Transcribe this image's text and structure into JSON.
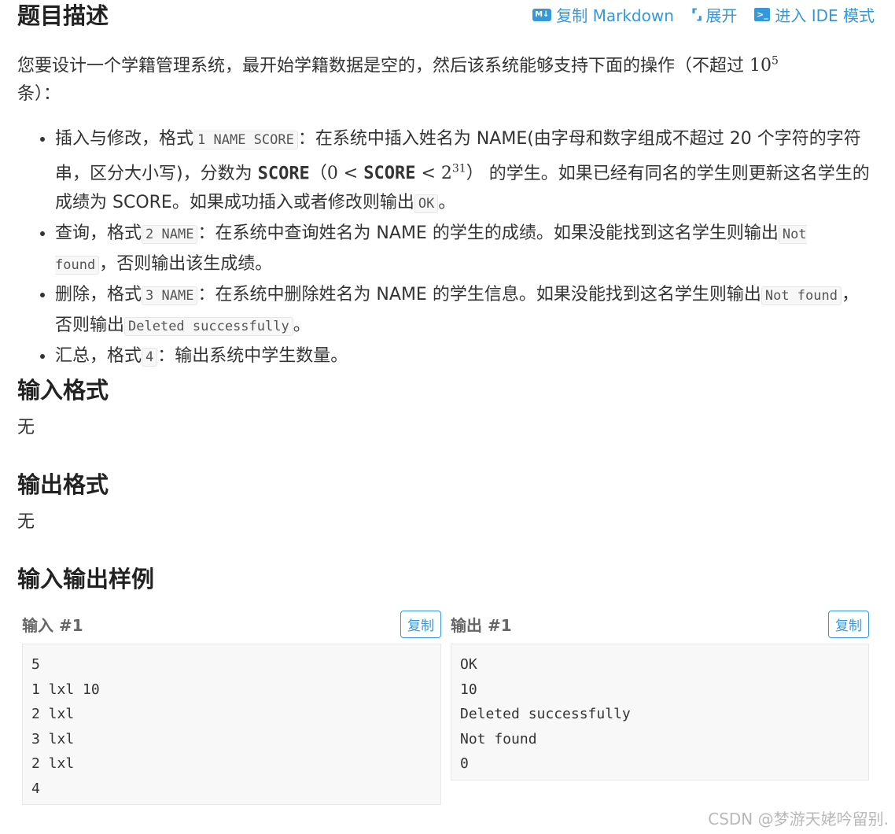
{
  "header": {
    "title": "题目描述",
    "toolbar": {
      "copy_markdown": "复制 Markdown",
      "md_icon_text": "M↓",
      "expand": "展开",
      "ide_mode": "进入 IDE 模式",
      "term_icon_text": ">_"
    }
  },
  "description": {
    "text_before": "您要设计一个学籍管理系统，最开始学籍数据是空的，然后该系统能够支持下面的操作（不超过 ",
    "limit_base": "10",
    "limit_exp": "5",
    "text_after": "条）："
  },
  "operations": [
    {
      "pre": "插入与修改，格式",
      "code": "1 NAME SCORE",
      "mid": "：在系统中插入姓名为 NAME(由字母和数字组成不超过 20 个字符的字符串，区分大小写)，分数为 ",
      "score_var": "SCORE",
      "math_open": "（0 < ",
      "math_lt": " < 2",
      "math_exp": "31",
      "math_close": "）",
      "post": " 的学生。如果已经有同名的学生则更新这名学生的成绩为 SCORE。如果成功插入或者修改则输出",
      "code2": "OK",
      "end": "。"
    },
    {
      "pre": "查询，格式",
      "code": "2 NAME",
      "mid": "：在系统中查询姓名为 NAME 的学生的成绩。如果没能找到这名学生则输出",
      "code2": "Not found",
      "end": "，否则输出该生成绩。"
    },
    {
      "pre": "删除，格式",
      "code": "3 NAME",
      "mid": "：在系统中删除姓名为 NAME 的学生信息。如果没能找到这名学生则输出",
      "code2": "Not found",
      "mid2": "，否则输出",
      "code3": "Deleted successfully",
      "end": "。"
    },
    {
      "pre": "汇总，格式",
      "code": "4",
      "mid": "：输出系统中学生数量。"
    }
  ],
  "input_format": {
    "title": "输入格式",
    "body": "无"
  },
  "output_format": {
    "title": "输出格式",
    "body": "无"
  },
  "samples": {
    "title": "输入输出样例",
    "input_label": "输入 #1",
    "output_label": "输出 #1",
    "copy_label": "复制",
    "input_lines": [
      "5",
      "1 lxl 10",
      "2 lxl",
      "3 lxl",
      "2 lxl",
      "4"
    ],
    "output_lines": [
      "OK",
      "10",
      "Deleted successfully",
      "Not found",
      "0"
    ]
  },
  "watermark": "CSDN @梦游天姥吟留别.",
  "colors": {
    "accent": "#3498db",
    "text": "#333333"
  }
}
